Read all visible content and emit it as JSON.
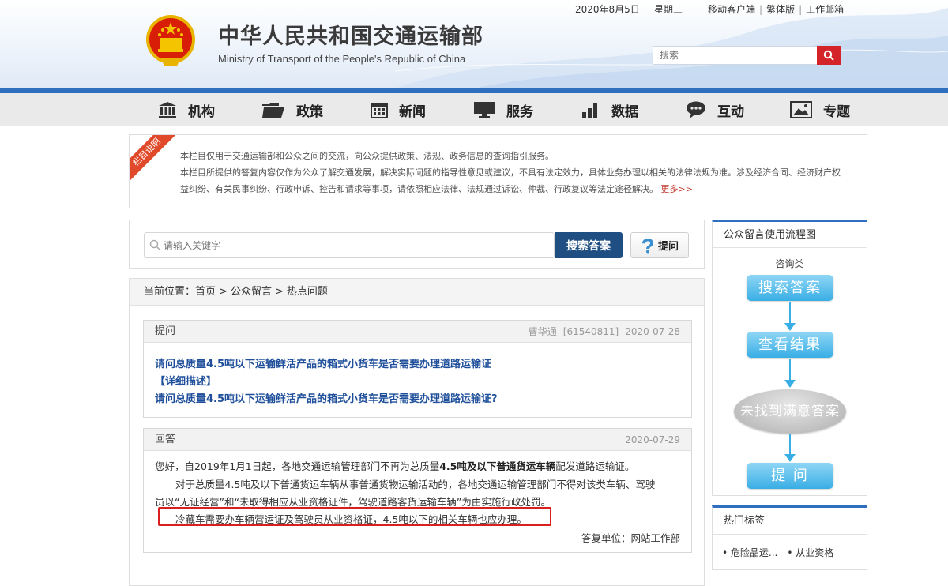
{
  "header": {
    "title": "中华人民共和国交通运输部",
    "subtitle": "Ministry of Transport of the People's Republic of China",
    "date": "2020年8月5日",
    "weekday": "星期三",
    "links": [
      "移动客户端",
      "繁体版",
      "工作邮箱"
    ],
    "search_placeholder": "搜索"
  },
  "nav": {
    "items": [
      {
        "label": "机构",
        "icon": "building-icon"
      },
      {
        "label": "政策",
        "icon": "folder-icon"
      },
      {
        "label": "新闻",
        "icon": "calendar-icon"
      },
      {
        "label": "服务",
        "icon": "monitor-icon"
      },
      {
        "label": "数据",
        "icon": "bar-chart-icon"
      },
      {
        "label": "互动",
        "icon": "chat-icon"
      },
      {
        "label": "专题",
        "icon": "image-icon"
      }
    ]
  },
  "notice": {
    "ribbon": "栏目说明",
    "line1": "本栏目仅用于交通运输部和公众之间的交流，向公众提供政策、法规、政务信息的查询指引服务。",
    "line2": "本栏目所提供的答复内容仅作为公众了解交通发展，解决实际问题的指导性意见或建议，不具有法定效力，具体业务办理以相关的法律法规为准。涉及经济合同、经济财产权",
    "line3": "益纠纷、有关民事纠纷、行政申诉、控告和请求等事项，请依照相应法律、法规通过诉讼、仲裁、行政复议等法定途径解决。",
    "more": "更多>>"
  },
  "search_panel": {
    "placeholder": "请输入关键字",
    "search_button": "搜索答案",
    "ask_button": "提问"
  },
  "breadcrumb": {
    "label": "当前位置：",
    "items": [
      "首页",
      "公众留言",
      "热点问题"
    ],
    "sep": ">"
  },
  "question": {
    "header": "提问",
    "author": "曹华通",
    "id": "[61540811]",
    "date": "2020-07-28",
    "title": "请问总质量4.5吨以下运输鲜活产品的箱式小货车是否需要办理道路运输证",
    "detail_label": "【详细描述】",
    "detail": "请问总质量4.5吨以下运输鲜活产品的箱式小货车是否需要办理道路运输证?"
  },
  "answer": {
    "header": "回答",
    "date": "2020-07-29",
    "p1_a": "您好，自2019年1月1日起，各地交通运输管理部门不再为总质量",
    "p1_b": "4.5吨及以下普通货运车辆",
    "p1_c": "配发道路运输证。",
    "p2_line1": "对于总质量4.5吨及以下普通货运车辆从事普通货物运输活动的，各地交通运输管理部门不得对该类车辆、驾驶",
    "p2_line2": "员以“无证经营”和“未取得相应从业资格证件，驾驶道路客货运输车辆”为由实施行政处罚。",
    "p3": "冷藏车需要办车辆营运证及驾驶员从业资格证，4.5吨以下的相关车辆也应办理。",
    "unit": "答复单位：网站工作部"
  },
  "flow": {
    "title": "公众留言使用流程图",
    "category": "咨询类",
    "steps": [
      "搜索答案",
      "查看结果",
      "未找到满意答案",
      "提 问"
    ]
  },
  "tags": {
    "title": "热门标签",
    "items": [
      "• 危险品运...",
      "• 从业资格"
    ]
  },
  "colors": {
    "nav_bg": "#eaeaea",
    "brand_blue": "#1f4e82",
    "link_blue": "#1f4f9a",
    "search_red": "#d5232a",
    "highlight_red": "#d9201f",
    "flow_blue": "#39aee5"
  }
}
